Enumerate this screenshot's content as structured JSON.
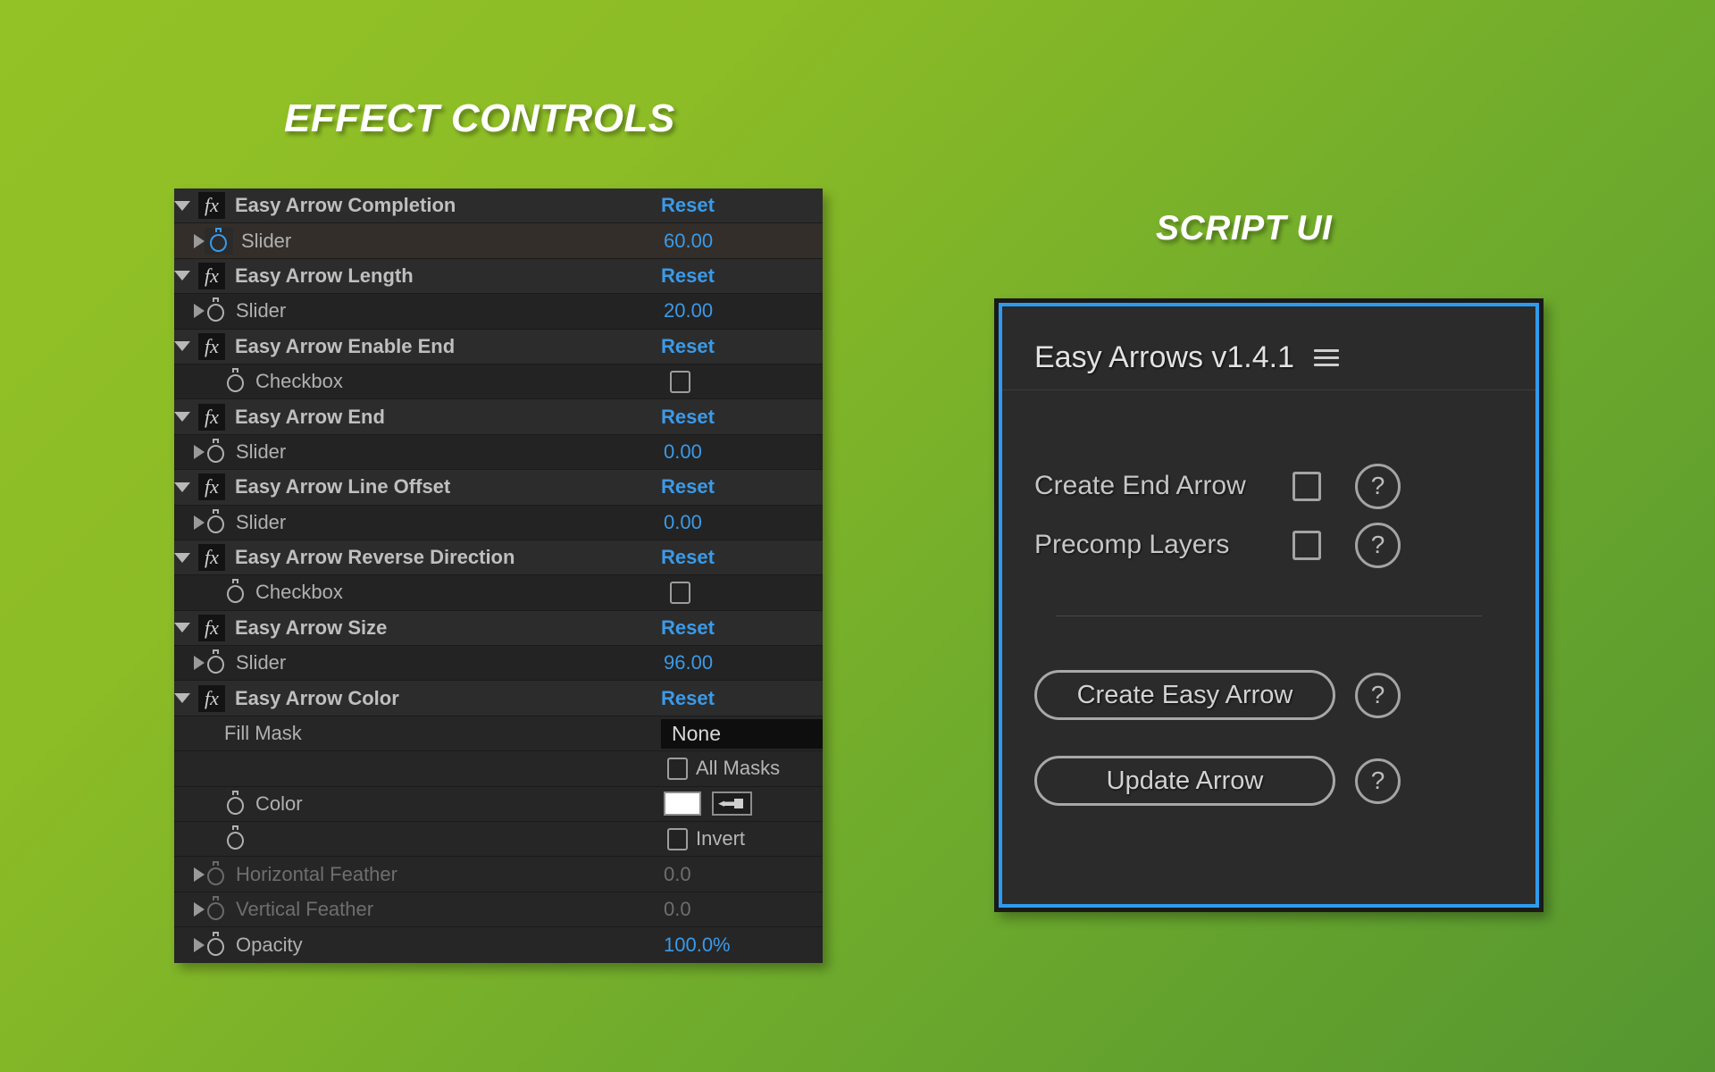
{
  "headings": {
    "effect_controls": "EFFECT CONTROLS",
    "script_ui": "SCRIPT UI"
  },
  "effect_controls": {
    "reset_label": "Reset",
    "rows": [
      {
        "kind": "effect",
        "label": "Easy Arrow Completion",
        "reset": "Reset"
      },
      {
        "kind": "prop",
        "label": "Slider",
        "value": "60.00",
        "active": true
      },
      {
        "kind": "effect",
        "label": "Easy Arrow Length",
        "reset": "Reset"
      },
      {
        "kind": "prop",
        "label": "Slider",
        "value": "20.00"
      },
      {
        "kind": "effect",
        "label": "Easy Arrow Enable End",
        "reset": "Reset"
      },
      {
        "kind": "checkbox",
        "label": "Checkbox",
        "checked": false
      },
      {
        "kind": "effect",
        "label": "Easy Arrow End",
        "reset": "Reset"
      },
      {
        "kind": "prop",
        "label": "Slider",
        "value": "0.00"
      },
      {
        "kind": "effect",
        "label": "Easy Arrow Line Offset",
        "reset": "Reset"
      },
      {
        "kind": "prop",
        "label": "Slider",
        "value": "0.00"
      },
      {
        "kind": "effect",
        "label": "Easy Arrow Reverse Direction",
        "reset": "Reset"
      },
      {
        "kind": "checkbox",
        "label": "Checkbox",
        "checked": false
      },
      {
        "kind": "effect",
        "label": "Easy Arrow Size",
        "reset": "Reset"
      },
      {
        "kind": "prop",
        "label": "Slider",
        "value": "96.00"
      },
      {
        "kind": "effect",
        "label": "Easy Arrow Color",
        "reset": "Reset"
      },
      {
        "kind": "dropdown",
        "label": "Fill Mask",
        "value": "None"
      },
      {
        "kind": "allmasks",
        "label": "All Masks",
        "checked": false
      },
      {
        "kind": "color",
        "label": "Color",
        "swatch": "#ffffff"
      },
      {
        "kind": "invert",
        "label": "Invert",
        "checked": false
      },
      {
        "kind": "prop",
        "label": "Horizontal Feather",
        "value": "0.0",
        "dim": true
      },
      {
        "kind": "prop",
        "label": "Vertical Feather",
        "value": "0.0",
        "dim": true
      },
      {
        "kind": "prop",
        "label": "Opacity",
        "value": "100.0%"
      }
    ],
    "colors": {
      "accent_blue": "#3b9ae8",
      "panel_bg": "#232323",
      "row_effect_bg": "#2c2c2c"
    }
  },
  "script_ui": {
    "title": "Easy Arrows v1.4.1",
    "menu_icon": "hamburger-icon",
    "checkboxes": [
      {
        "label": "Create End Arrow",
        "checked": false,
        "help": "?"
      },
      {
        "label": "Precomp Layers",
        "checked": false,
        "help": "?"
      }
    ],
    "buttons": [
      {
        "label": "Create Easy Arrow",
        "help": "?"
      },
      {
        "label": "Update Arrow",
        "help": "?"
      }
    ],
    "colors": {
      "border": "#2e9bee",
      "panel_bg": "#2b2b2b"
    }
  },
  "background": {
    "from": "#93c226",
    "to": "#559630"
  }
}
